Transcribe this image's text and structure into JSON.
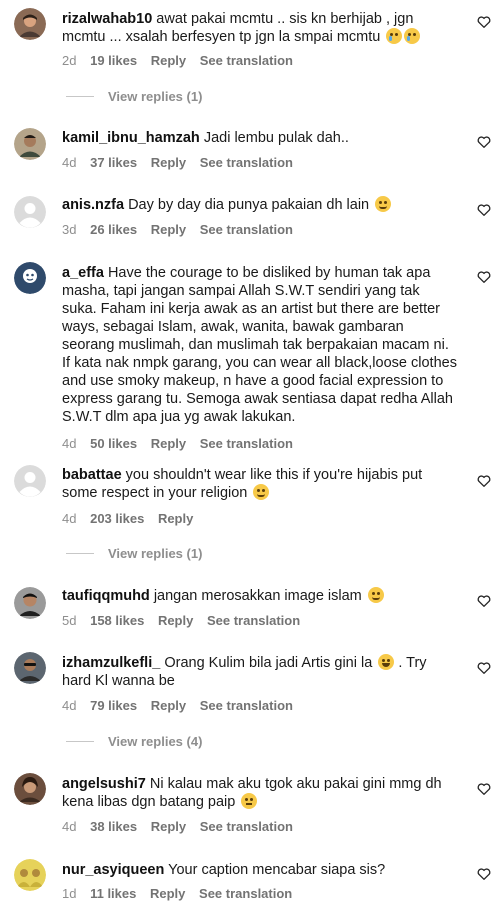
{
  "comments": [
    {
      "username": "rizalwahab10",
      "text": "awat pakai mcmtu .. sis kn berhijab , jgn mcmtu ... xsalah berfesyen tp jgn la smpai mcmtu",
      "emojis": [
        "crying-face",
        "crying-face"
      ],
      "time": "2d",
      "likes": "19 likes",
      "reply": "Reply",
      "translate": "See translation",
      "view_replies": "View replies (1)"
    },
    {
      "username": "kamil_ibnu_hamzah",
      "text": "Jadi lembu pulak dah..",
      "emojis": [],
      "time": "4d",
      "likes": "37 likes",
      "reply": "Reply",
      "translate": "See translation"
    },
    {
      "username": "anis.nzfa",
      "text": "Day by day dia punya pakaian dh lain",
      "emojis": [
        "relieved-face"
      ],
      "time": "3d",
      "likes": "26 likes",
      "reply": "Reply",
      "translate": "See translation"
    },
    {
      "username": "a_effa",
      "text": "Have the courage to be disliked by human tak apa masha, tapi jangan sampai Allah S.W.T sendiri yang tak suka. Faham ini kerja awak as an artist but there are better ways, sebagai Islam, awak, wanita, bawak gambaran seorang muslimah, dan muslimah tak berpakaian macam ni. If kata nak nmpk garang, you can wear all black,loose clothes and use smoky makeup, n have a good facial expression to express garang tu. Semoga awak sentiasa dapat redha Allah S.W.T dlm apa jua yg awak lakukan.",
      "emojis": [],
      "time": "4d",
      "likes": "50 likes",
      "reply": "Reply",
      "translate": "See translation"
    },
    {
      "username": "babattae",
      "text": "you shouldn't wear like this if you're hijabis put some respect in your religion",
      "emojis": [
        "relieved-face"
      ],
      "time": "4d",
      "likes": "203 likes",
      "reply": "Reply",
      "view_replies": "View replies (1)"
    },
    {
      "username": "taufiqqmuhd",
      "text": "jangan merosakkan image islam",
      "emojis": [
        "smiling-face"
      ],
      "time": "5d",
      "likes": "158 likes",
      "reply": "Reply",
      "translate": "See translation"
    },
    {
      "username": "izhamzulkefli_",
      "text": "Orang Kulim bila jadi Artis gini la",
      "text2": ". Try hard Kl wanna be",
      "emojis": [
        "laughing-face"
      ],
      "time": "4d",
      "likes": "79 likes",
      "reply": "Reply",
      "translate": "See translation",
      "view_replies": "View replies (4)"
    },
    {
      "username": "angelsushi7",
      "text": "Ni kalau mak aku tgok aku pakai gini mmg dh kena libas dgn batang paip",
      "emojis": [
        "neutral-face"
      ],
      "time": "4d",
      "likes": "38 likes",
      "reply": "Reply",
      "translate": "See translation"
    },
    {
      "username": "nur_asyiqueen",
      "text": "Your caption mencabar siapa sis?",
      "emojis": [],
      "time": "1d",
      "likes": "11 likes",
      "reply": "Reply",
      "translate": "See translation"
    }
  ],
  "colors": {
    "text": "#1a1a1a",
    "meta": "#8e8e8e",
    "divider": "#c7c7c7"
  },
  "icons": {
    "like": "heart-outline-icon",
    "default_avatar": "default-avatar-icon"
  }
}
